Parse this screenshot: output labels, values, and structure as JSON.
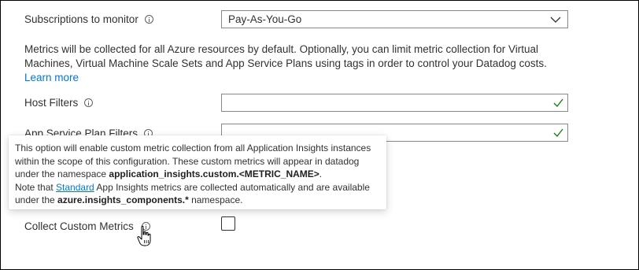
{
  "subscriptions": {
    "label": "Subscriptions to monitor",
    "selected": "Pay-As-You-Go"
  },
  "description": {
    "text": "Metrics will be collected for all Azure resources by default. Optionally, you can limit metric collection for Virtual Machines, Virtual Machine Scale Sets and App Service Plans using tags in order to control your Datadog costs.",
    "learn_more": "Learn more"
  },
  "host_filters": {
    "label": "Host Filters",
    "value": "",
    "status_icon": "check-icon",
    "status_color": "#107c10"
  },
  "app_service_plan_filters": {
    "label": "App Service Plan Filters",
    "value": "",
    "status_icon": "check-icon",
    "status_color": "#107c10"
  },
  "tooltip": {
    "line1": "This option will enable custom metric collection from all Application Insights instances",
    "line2": "within the scope of this configuration. These custom metrics will appear in datadog",
    "line3_pre": "under the namespace ",
    "line3_bold": "application_insights.custom.<METRIC_NAME>",
    "line3_post": ".",
    "line4_pre": "Note that ",
    "line4_link": "Standard",
    "line4_post": " App Insights metrics are collected automatically and are available",
    "line5_pre": "under the ",
    "line5_bold": "azure.insights_components.*",
    "line5_post": " namespace."
  },
  "collect_custom_metrics": {
    "label": "Collect Custom Metrics",
    "checked": false
  },
  "colors": {
    "link": "#0078d4",
    "border": "#8a8886",
    "text": "#323130"
  }
}
